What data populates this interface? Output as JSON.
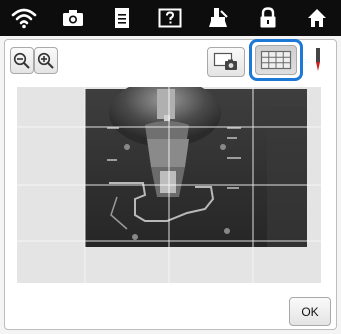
{
  "topbar": {
    "icons": [
      "wifi-icon",
      "camera-icon",
      "document-icon",
      "help-icon",
      "sewing-presser-icon",
      "lock-icon",
      "home-icon"
    ]
  },
  "toolbar": {
    "zoom_out": "zoom-out-icon",
    "zoom_in": "zoom-in-icon",
    "camera_view": "camera-view-icon",
    "grid": "grid-icon",
    "needle": "needle-icon",
    "grid_selected": true
  },
  "buttons": {
    "ok_label": "OK"
  },
  "colors": {
    "topbar_bg": "#0d0d0d",
    "selection_ring": "#1d78d6",
    "needle_red": "#d21a1a"
  }
}
